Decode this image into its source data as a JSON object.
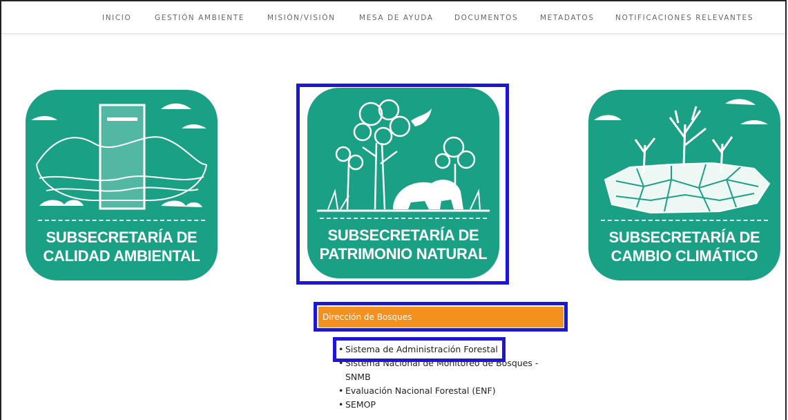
{
  "nav": {
    "items": [
      {
        "label": "INICIO"
      },
      {
        "label": "GESTIÓN AMBIENTE"
      },
      {
        "label": "MISIÓN/VISIÓN"
      },
      {
        "label": "MESA DE AYUDA"
      },
      {
        "label": "DOCUMENTOS"
      },
      {
        "label": "METADATOS"
      },
      {
        "label": "NOTIFICACIONES RELEVANTES"
      }
    ]
  },
  "cards": [
    {
      "line1": "SUBSECRETARÍA DE",
      "line2": "CALIDAD AMBIENTAL",
      "icon": "waterfall-icon"
    },
    {
      "line1": "SUBSECRETARÍA DE",
      "line2": "PATRIMONIO NATURAL",
      "icon": "forest-bear-icon"
    },
    {
      "line1": "SUBSECRETARÍA DE",
      "line2": "CAMBIO CLIMÁTICO",
      "icon": "cracked-earth-icon"
    }
  ],
  "section": {
    "title": "Dirección de Bosques"
  },
  "links": [
    {
      "label": "Sistema de Administración Forestal"
    },
    {
      "label": "Sistema Nacional de Monitoreo de Bosques -"
    },
    {
      "label": "SNMB"
    },
    {
      "label": "Evaluación Nacional Forestal (ENF)"
    },
    {
      "label": "SEMOP"
    }
  ],
  "colors": {
    "card": "#1aa085",
    "highlight": "#1d16d6",
    "section_bar": "#f4911e"
  }
}
